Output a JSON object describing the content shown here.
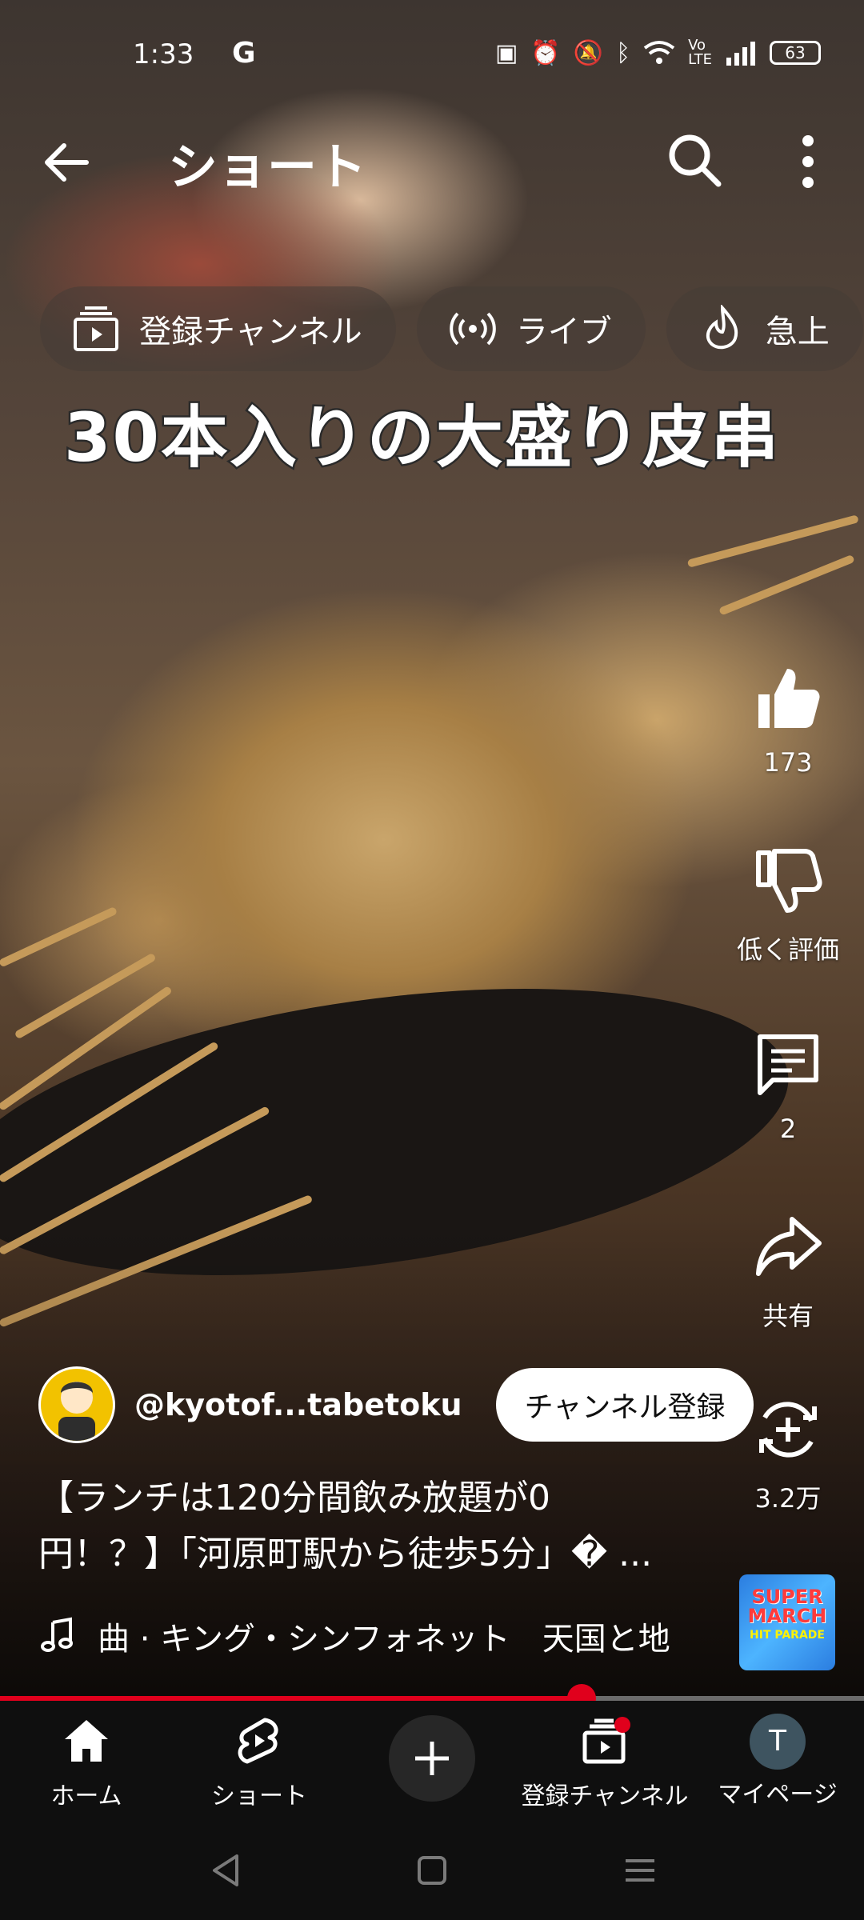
{
  "status_bar": {
    "time": "1:33",
    "g_label": "G",
    "battery": "63",
    "icons": [
      "nfc-icon",
      "alarm-icon",
      "mute-icon",
      "bluetooth-icon",
      "wifi-icon",
      "volte-icon",
      "signal-icon",
      "battery-icon"
    ]
  },
  "header": {
    "title": "ショート"
  },
  "chips": [
    {
      "label": "登録チャンネル",
      "icon": "subscriptions-icon"
    },
    {
      "label": "ライブ",
      "icon": "live-icon"
    },
    {
      "label": "急上",
      "icon": "trending-icon"
    }
  ],
  "video": {
    "caption": "30本入りの大盛り皮串"
  },
  "actions": {
    "like_count": "173",
    "dislike_label": "低く評価",
    "comment_count": "2",
    "share_label": "共有",
    "remix_count": "3.2万"
  },
  "channel": {
    "handle": "@kyotof...tabetoku",
    "subscribe_label": "チャンネル登録"
  },
  "video_title": {
    "line1": "【ランチは120分間飲み放題が0",
    "line2": "円！？】「河原町駅から徒歩5分」� ..."
  },
  "music": {
    "text": "曲 · キング・シンフォネット　天国と地",
    "thumb_line1": "SUPER MARCH",
    "thumb_line2": "HIT PARADE"
  },
  "progress": {
    "fraction": 0.673
  },
  "bottom_nav": {
    "home": "ホーム",
    "shorts": "ショート",
    "subscriptions": "登録チャンネル",
    "mypage": "マイページ",
    "avatar_letter": "T"
  },
  "colors": {
    "accent": "#e0001c",
    "nav_bg": "#0f0f0f"
  }
}
